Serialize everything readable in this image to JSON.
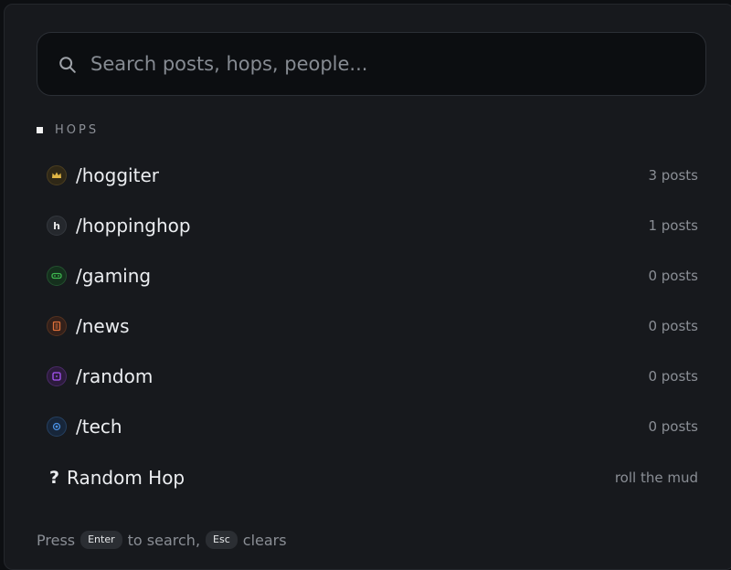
{
  "search": {
    "placeholder": "Search posts, hops, people..."
  },
  "section": {
    "title": "HOPS"
  },
  "hops": [
    {
      "name": "/hoggiter",
      "meta": "3 posts",
      "icon": "crown-icon",
      "color": "#e0b545"
    },
    {
      "name": "/hoppinghop",
      "meta": "1 posts",
      "icon": "letter-h-icon",
      "color": "#d8d8d8"
    },
    {
      "name": "/gaming",
      "meta": "0 posts",
      "icon": "gamepad-icon",
      "color": "#3fb950"
    },
    {
      "name": "/news",
      "meta": "0 posts",
      "icon": "newspaper-icon",
      "color": "#e0703a"
    },
    {
      "name": "/random",
      "meta": "0 posts",
      "icon": "dice-icon",
      "color": "#a855f7"
    },
    {
      "name": "/tech",
      "meta": "0 posts",
      "icon": "chip-icon",
      "color": "#4a8fe0"
    }
  ],
  "random_hop": {
    "symbol": "?",
    "label": "Random Hop",
    "meta": "roll the mud"
  },
  "footer": {
    "press": "Press",
    "enter_key": "Enter",
    "to_search": "to search,",
    "esc_key": "Esc",
    "clears": "clears"
  }
}
